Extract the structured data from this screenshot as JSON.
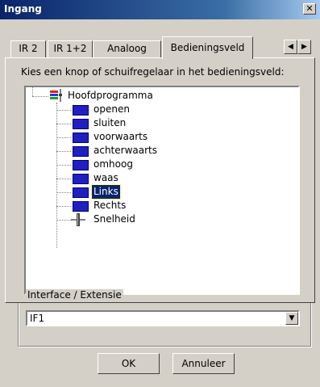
{
  "window": {
    "title": "Ingang",
    "close_label": "✕"
  },
  "tabs": [
    {
      "label": "IR 2",
      "active": false
    },
    {
      "label": "IR 1+2",
      "active": false
    },
    {
      "label": "Analoog",
      "active": false
    },
    {
      "label": "Bedieningsveld",
      "active": true
    }
  ],
  "tab_scroll": {
    "left": "◀",
    "right": "▶"
  },
  "instruction": "Kies een knop of schuifregelaar in het bedieningsveld:",
  "tree": {
    "root": "Hoofdprogramma",
    "items": [
      {
        "label": "openen",
        "type": "button",
        "selected": false
      },
      {
        "label": "sluiten",
        "type": "button",
        "selected": false
      },
      {
        "label": "voorwaarts",
        "type": "button",
        "selected": false
      },
      {
        "label": "achterwaarts",
        "type": "button",
        "selected": false
      },
      {
        "label": "omhoog",
        "type": "button",
        "selected": false
      },
      {
        "label": "waas",
        "type": "button",
        "selected": false
      },
      {
        "label": "Links",
        "type": "button",
        "selected": true
      },
      {
        "label": "Rechts",
        "type": "button",
        "selected": false
      },
      {
        "label": "Snelheid",
        "type": "slider",
        "selected": false
      }
    ]
  },
  "interface": {
    "legend": "Interface / Extensie",
    "selected": "IF1",
    "dropdown_arrow": "▼"
  },
  "buttons": {
    "ok": "OK",
    "cancel": "Annuleer"
  },
  "colors": {
    "title_bar": "#0a246a",
    "selection": "#0a246a",
    "button_icon": "#2020c0",
    "dialog_bg": "#d4d0c8"
  }
}
